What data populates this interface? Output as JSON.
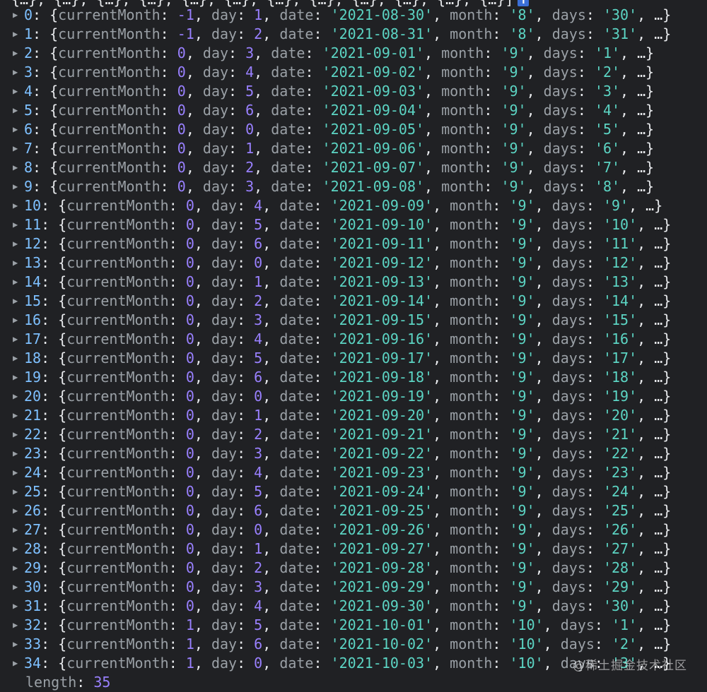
{
  "console": {
    "top_line_text": "{…}, {…}, {…}, {…}, {…}, {…}, {…}, {…}, {…}, {…}, {…}, {…}]",
    "info_badge": "i",
    "length_key": "length",
    "length_value": "35",
    "watermark": "@稀土掘金技术社区",
    "rows": [
      {
        "index": "0",
        "currentMonth": "-1",
        "day": "1",
        "date": "'2021-08-30'",
        "month": "'8'",
        "days": "'30'"
      },
      {
        "index": "1",
        "currentMonth": "-1",
        "day": "2",
        "date": "'2021-08-31'",
        "month": "'8'",
        "days": "'31'"
      },
      {
        "index": "2",
        "currentMonth": "0",
        "day": "3",
        "date": "'2021-09-01'",
        "month": "'9'",
        "days": "'1'"
      },
      {
        "index": "3",
        "currentMonth": "0",
        "day": "4",
        "date": "'2021-09-02'",
        "month": "'9'",
        "days": "'2'"
      },
      {
        "index": "4",
        "currentMonth": "0",
        "day": "5",
        "date": "'2021-09-03'",
        "month": "'9'",
        "days": "'3'"
      },
      {
        "index": "5",
        "currentMonth": "0",
        "day": "6",
        "date": "'2021-09-04'",
        "month": "'9'",
        "days": "'4'"
      },
      {
        "index": "6",
        "currentMonth": "0",
        "day": "0",
        "date": "'2021-09-05'",
        "month": "'9'",
        "days": "'5'"
      },
      {
        "index": "7",
        "currentMonth": "0",
        "day": "1",
        "date": "'2021-09-06'",
        "month": "'9'",
        "days": "'6'"
      },
      {
        "index": "8",
        "currentMonth": "0",
        "day": "2",
        "date": "'2021-09-07'",
        "month": "'9'",
        "days": "'7'"
      },
      {
        "index": "9",
        "currentMonth": "0",
        "day": "3",
        "date": "'2021-09-08'",
        "month": "'9'",
        "days": "'8'"
      },
      {
        "index": "10",
        "currentMonth": "0",
        "day": "4",
        "date": "'2021-09-09'",
        "month": "'9'",
        "days": "'9'"
      },
      {
        "index": "11",
        "currentMonth": "0",
        "day": "5",
        "date": "'2021-09-10'",
        "month": "'9'",
        "days": "'10'"
      },
      {
        "index": "12",
        "currentMonth": "0",
        "day": "6",
        "date": "'2021-09-11'",
        "month": "'9'",
        "days": "'11'"
      },
      {
        "index": "13",
        "currentMonth": "0",
        "day": "0",
        "date": "'2021-09-12'",
        "month": "'9'",
        "days": "'12'"
      },
      {
        "index": "14",
        "currentMonth": "0",
        "day": "1",
        "date": "'2021-09-13'",
        "month": "'9'",
        "days": "'13'"
      },
      {
        "index": "15",
        "currentMonth": "0",
        "day": "2",
        "date": "'2021-09-14'",
        "month": "'9'",
        "days": "'14'"
      },
      {
        "index": "16",
        "currentMonth": "0",
        "day": "3",
        "date": "'2021-09-15'",
        "month": "'9'",
        "days": "'15'"
      },
      {
        "index": "17",
        "currentMonth": "0",
        "day": "4",
        "date": "'2021-09-16'",
        "month": "'9'",
        "days": "'16'"
      },
      {
        "index": "18",
        "currentMonth": "0",
        "day": "5",
        "date": "'2021-09-17'",
        "month": "'9'",
        "days": "'17'"
      },
      {
        "index": "19",
        "currentMonth": "0",
        "day": "6",
        "date": "'2021-09-18'",
        "month": "'9'",
        "days": "'18'"
      },
      {
        "index": "20",
        "currentMonth": "0",
        "day": "0",
        "date": "'2021-09-19'",
        "month": "'9'",
        "days": "'19'"
      },
      {
        "index": "21",
        "currentMonth": "0",
        "day": "1",
        "date": "'2021-09-20'",
        "month": "'9'",
        "days": "'20'"
      },
      {
        "index": "22",
        "currentMonth": "0",
        "day": "2",
        "date": "'2021-09-21'",
        "month": "'9'",
        "days": "'21'"
      },
      {
        "index": "23",
        "currentMonth": "0",
        "day": "3",
        "date": "'2021-09-22'",
        "month": "'9'",
        "days": "'22'"
      },
      {
        "index": "24",
        "currentMonth": "0",
        "day": "4",
        "date": "'2021-09-23'",
        "month": "'9'",
        "days": "'23'"
      },
      {
        "index": "25",
        "currentMonth": "0",
        "day": "5",
        "date": "'2021-09-24'",
        "month": "'9'",
        "days": "'24'"
      },
      {
        "index": "26",
        "currentMonth": "0",
        "day": "6",
        "date": "'2021-09-25'",
        "month": "'9'",
        "days": "'25'"
      },
      {
        "index": "27",
        "currentMonth": "0",
        "day": "0",
        "date": "'2021-09-26'",
        "month": "'9'",
        "days": "'26'"
      },
      {
        "index": "28",
        "currentMonth": "0",
        "day": "1",
        "date": "'2021-09-27'",
        "month": "'9'",
        "days": "'27'"
      },
      {
        "index": "29",
        "currentMonth": "0",
        "day": "2",
        "date": "'2021-09-28'",
        "month": "'9'",
        "days": "'28'"
      },
      {
        "index": "30",
        "currentMonth": "0",
        "day": "3",
        "date": "'2021-09-29'",
        "month": "'9'",
        "days": "'29'"
      },
      {
        "index": "31",
        "currentMonth": "0",
        "day": "4",
        "date": "'2021-09-30'",
        "month": "'9'",
        "days": "'30'"
      },
      {
        "index": "32",
        "currentMonth": "1",
        "day": "5",
        "date": "'2021-10-01'",
        "month": "'10'",
        "days": "'1'"
      },
      {
        "index": "33",
        "currentMonth": "1",
        "day": "6",
        "date": "'2021-10-02'",
        "month": "'10'",
        "days": "'2'"
      },
      {
        "index": "34",
        "currentMonth": "1",
        "day": "0",
        "date": "'2021-10-03'",
        "month": "'10'",
        "days": "'3'"
      }
    ]
  }
}
